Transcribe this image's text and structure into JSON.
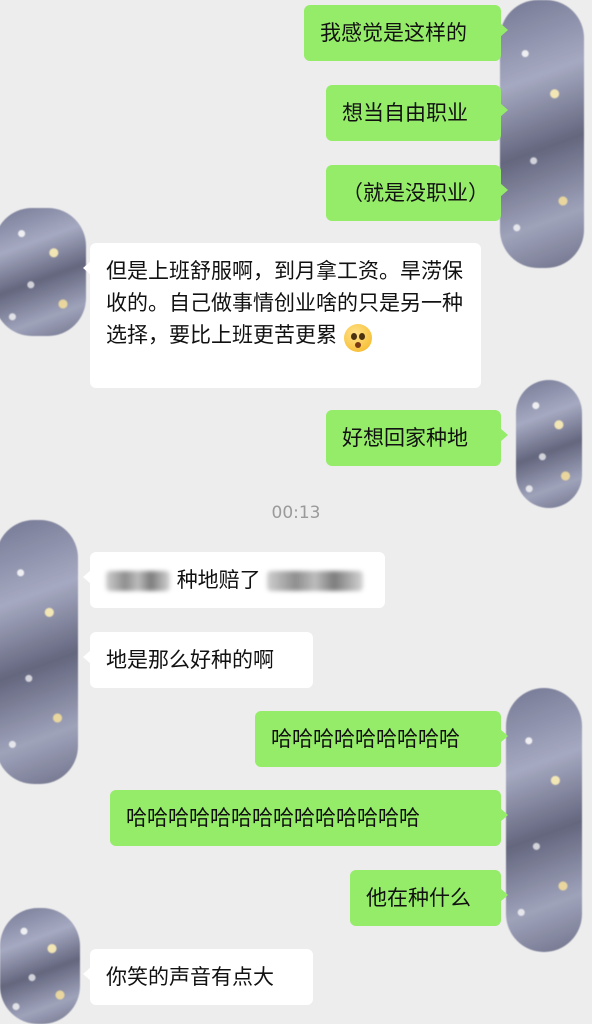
{
  "messages": {
    "m1": "我感觉是这样的",
    "m2": "想当自由职业",
    "m3": "（就是没职业）",
    "m4": "但是上班舒服啊，到月拿工资。旱涝保收的。自己做事情创业啥的只是另一种选择，要比上班更苦更累",
    "m4_emoji": "flushed-face-emoji",
    "m5": "好想回家种地",
    "timestamp": "00:13",
    "m6_text": "种地赔了",
    "m7": "地是那么好种的啊",
    "m8": "哈哈哈哈哈哈哈哈哈",
    "m9": "哈哈哈哈哈哈哈哈哈哈哈哈哈哈",
    "m10": "他在种什么",
    "m11": "你笑的声音有点大"
  },
  "colors": {
    "background": "#ededed",
    "sent_bubble": "#95ec69",
    "received_bubble": "#ffffff",
    "timestamp_text": "#9a9a9a"
  }
}
